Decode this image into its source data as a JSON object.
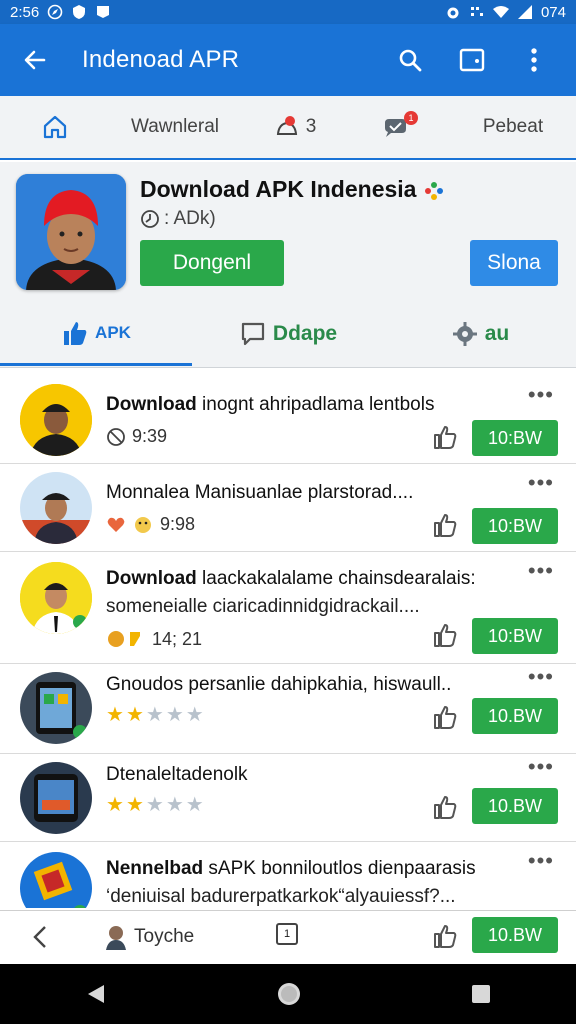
{
  "status_bar": {
    "time": "2:56",
    "battery": "074"
  },
  "app_bar": {
    "title": "Indenoad APR",
    "icons": [
      "back-arrow-icon",
      "search-icon",
      "window-icon",
      "more-vert-icon"
    ]
  },
  "top_tabs": [
    {
      "label": "",
      "icon": "home-icon"
    },
    {
      "label": "Wawnleral",
      "icon": ""
    },
    {
      "label": "3",
      "icon": "bell-icon"
    },
    {
      "label": "",
      "icon": "chat-icon",
      "badge": "1"
    },
    {
      "label": "Pebeat",
      "icon": ""
    }
  ],
  "featured": {
    "title": "Download APK Indenesia",
    "subtitle": ": ADk)",
    "primary_button": "Dongenl",
    "secondary_button": "Slona",
    "sub_tabs": [
      {
        "label": "APK",
        "icon": "thumbs-up-icon"
      },
      {
        "label": "Ddape",
        "icon": "comment-icon"
      },
      {
        "label": "au",
        "icon": "gear-icon"
      }
    ]
  },
  "list": [
    {
      "title_bold": "Download",
      "title_rest": " inognt ahripadlama lentbols",
      "line2": "",
      "meta": "9:39",
      "rating": null,
      "button": "10:BW"
    },
    {
      "title_bold": "",
      "title_rest": "Monnalea Manisuanlae plarstorad....",
      "line2": "",
      "meta": "9:98",
      "rating": null,
      "button": "10:BW"
    },
    {
      "title_bold": "Download",
      "title_rest": " laackakalalame chainsdearalais:",
      "line2": "someneialle ciaricadinnidgidrackail....",
      "meta": "14; 21",
      "rating": null,
      "button": "10:BW"
    },
    {
      "title_bold": "",
      "title_rest": "Gnoudos persanlie dahipkahia, hiswaull..",
      "line2": "",
      "meta": "",
      "rating": 2,
      "button": "10.BW"
    },
    {
      "title_bold": "",
      "title_rest": "Dtenaleltadenolk",
      "line2": "",
      "meta": "",
      "rating": 2,
      "button": "10.BW"
    },
    {
      "title_bold": "Nennelbad",
      "title_rest": " sAPK bonniloutlos dienpaarasis",
      "line2": "‘deniuisal badurerpatkarkok“alyauiessf?...",
      "meta": "",
      "rating": null,
      "button": "10.BW"
    }
  ],
  "bottom_bar": {
    "label": "Toyche",
    "square_label": "1"
  },
  "colors": {
    "primary": "#1a73d6",
    "green": "#2aa84a",
    "blue_button": "#2f8be6"
  }
}
